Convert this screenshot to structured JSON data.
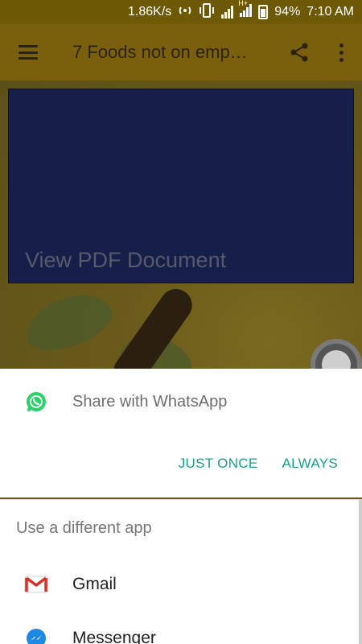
{
  "status_bar": {
    "speed": "1.86K/s",
    "battery": "94%",
    "time": "7:10 AM",
    "network_tag": "H+"
  },
  "app_bar": {
    "title": "7 Foods not on emp…"
  },
  "content": {
    "pdf_label": "View PDF Document"
  },
  "share_sheet": {
    "primary_app": "Share with WhatsApp",
    "just_once": "JUST ONCE",
    "always": "ALWAYS",
    "section_title": "Use a different app",
    "apps": [
      {
        "name": "Gmail",
        "icon": "gmail-icon"
      },
      {
        "name": "Messenger",
        "icon": "messenger-icon"
      }
    ]
  },
  "colors": {
    "accent": "#16a08a",
    "whatsapp_green": "#25d366",
    "messenger_blue": "#1e88e5",
    "gmail_red": "#d93025"
  }
}
